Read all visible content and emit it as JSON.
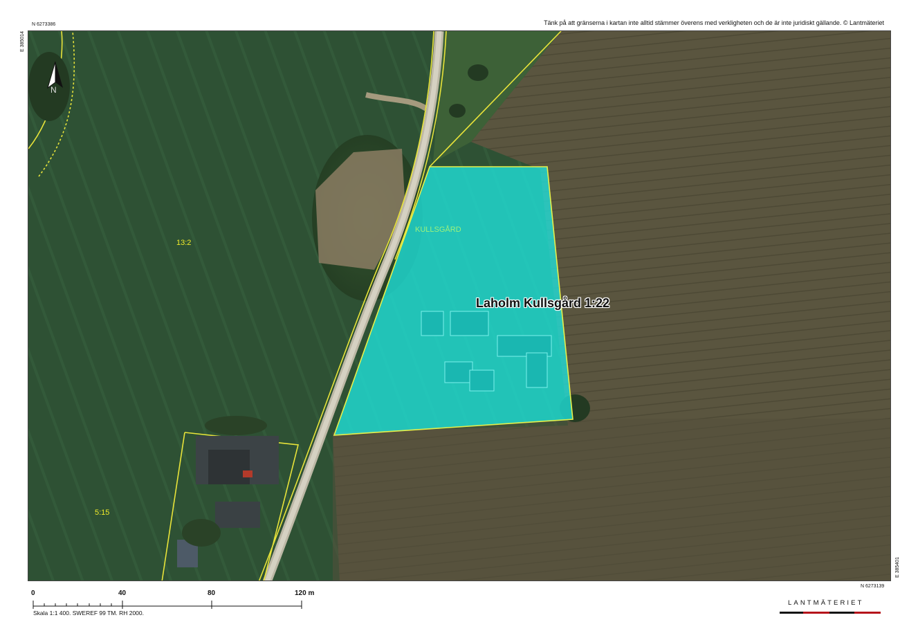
{
  "disclaimer": "Tänk på att gränserna i kartan inte alltid stämmer överens med verkligheten och de är inte juridiskt gällande. © Lantmäteriet",
  "coordinates": {
    "north_top": "N 6273386",
    "east_top": "E 385014",
    "east_bottom": "E 385401",
    "north_bottom": "N 6273139"
  },
  "parcel": {
    "name": "Laholm Kullsgård 1:22",
    "fill_color": "#1fe3dc",
    "outline_color": "#e6f04a"
  },
  "place_label": "KULLSGÅRD",
  "lot_labels": {
    "lot_13_2": "13:2",
    "lot_5_15": "5:15"
  },
  "north_arrow": {
    "label": "N",
    "icon": "north-arrow-icon"
  },
  "scalebar": {
    "ticks": [
      "0",
      "40",
      "80",
      "120 m"
    ],
    "caption": "Skala 1:1 400. SWEREF 99 TM. RH 2000."
  },
  "logo": {
    "text": "LANTMÄTERIET",
    "accent_color": "#b5121b"
  },
  "colors": {
    "field_green": "#2f5236",
    "plowed_field": "#59543f",
    "boundary_yellow": "#e9e43a",
    "road": "#c8c4b4"
  }
}
